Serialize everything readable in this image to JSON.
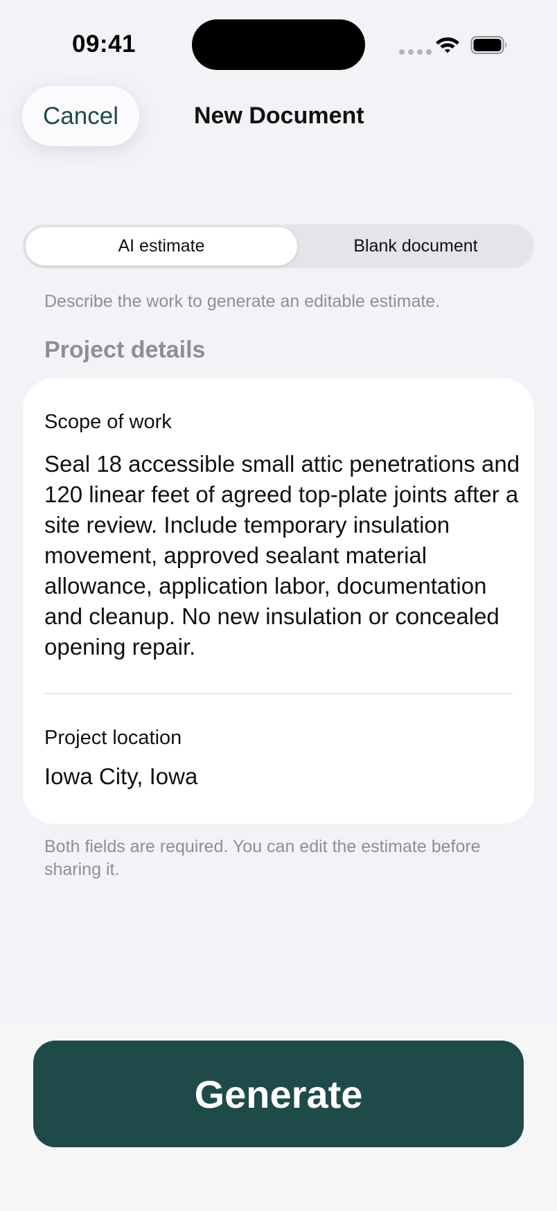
{
  "status_bar": {
    "time": "09:41"
  },
  "nav": {
    "cancel_label": "Cancel",
    "title": "New Document"
  },
  "mode_picker": {
    "options": [
      "AI estimate",
      "Blank document"
    ],
    "selected": "AI estimate"
  },
  "description": "Describe the work to generate an editable estimate.",
  "section_header": "Project details",
  "form": {
    "scope": {
      "label": "Scope of work",
      "value": "Seal 18 accessible small attic penetrations and 120 linear feet of agreed top-plate joints after a site review. Include temporary insulation movement, approved sealant material allowance, application labor, documentation and cleanup. No new insulation or concealed opening repair."
    },
    "location": {
      "label": "Project location",
      "value": "Iowa City, Iowa"
    }
  },
  "footnote": "Both fields are required. You can edit the estimate before sharing it.",
  "generate_label": "Generate",
  "colors": {
    "accent": "#1e4a4a",
    "background": "#f2f2f7",
    "secondary_text": "#8e8e93"
  }
}
